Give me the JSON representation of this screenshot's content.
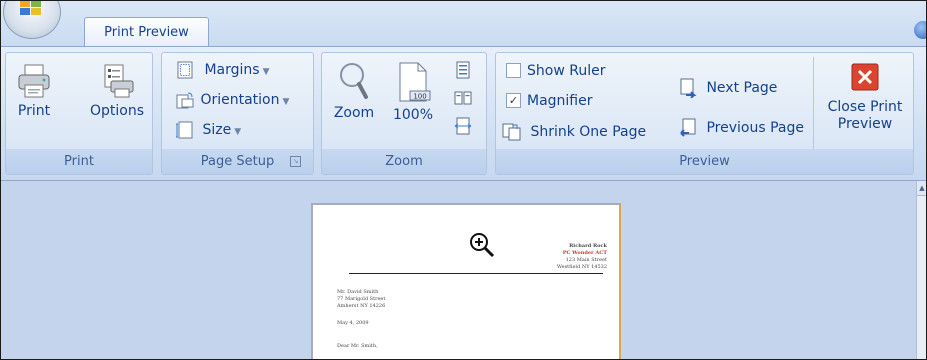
{
  "tabs": {
    "active": "Print Preview"
  },
  "groups": {
    "print": {
      "label": "Print",
      "print_label": "Print",
      "options_label": "Options"
    },
    "page_setup": {
      "label": "Page Setup",
      "margins": "Margins",
      "orientation": "Orientation",
      "size": "Size"
    },
    "zoom": {
      "label": "Zoom",
      "zoom_label": "Zoom",
      "hundred_label": "100%",
      "hundred_icon_text": "100"
    },
    "preview": {
      "label": "Preview",
      "show_ruler": "Show Ruler",
      "magnifier": "Magnifier",
      "shrink_one_page": "Shrink One Page",
      "next_page": "Next Page",
      "previous_page": "Previous Page",
      "close_line1": "Close Print",
      "close_line2": "Preview",
      "show_ruler_checked": false,
      "magnifier_checked": true
    }
  },
  "document": {
    "sender_name": "Richard Rock",
    "sender_company": "PC Wonder ACT",
    "sender_street": "123 Main Street",
    "sender_city": "Westfield NY 14532",
    "recipient_name": "Mr. David Smith",
    "recipient_street": "77 Marigold Street",
    "recipient_city": "Amherst NY 14226",
    "date": "May 4, 2009",
    "salutation": "Dear Mr. Smith,"
  },
  "colors": {
    "ribbon_text": "#15428b",
    "group_label_text": "#3b5f95",
    "close_button_red": "#d9452f",
    "page_border_accent": "#d7a64e",
    "sender_company_color": "#c0392b"
  }
}
